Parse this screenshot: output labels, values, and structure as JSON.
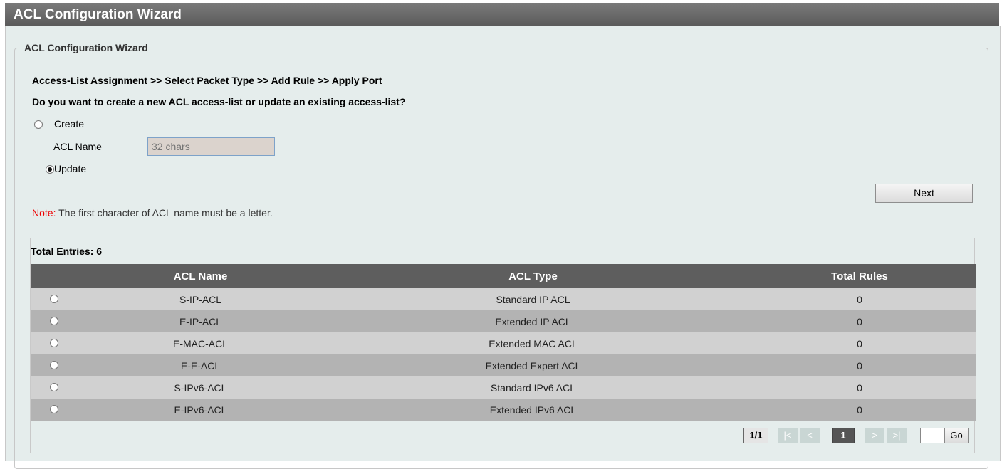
{
  "window": {
    "title": "ACL Configuration Wizard"
  },
  "wizard": {
    "legend": "ACL Configuration Wizard",
    "breadcrumb": {
      "current": "Access-List Assignment",
      "rest": " >> Select Packet Type >> Add Rule >> Apply Port"
    },
    "question": "Do you want to create a new ACL access-list or update an existing access-list?",
    "create_label": "Create",
    "acl_name_label": "ACL Name",
    "acl_name_placeholder": "32 chars",
    "update_label": "Update",
    "selected_option": "Update",
    "next_label": "Next",
    "note_label": "Note:",
    "note_text": "The first character of ACL name must be a letter."
  },
  "table": {
    "total_entries": "Total Entries: 6",
    "columns": [
      "",
      "ACL Name",
      "ACL Type",
      "Total Rules"
    ],
    "rows": [
      {
        "name": "S-IP-ACL",
        "type": "Standard IP ACL",
        "rules": "0"
      },
      {
        "name": "E-IP-ACL",
        "type": "Extended IP ACL",
        "rules": "0"
      },
      {
        "name": "E-MAC-ACL",
        "type": "Extended MAC ACL",
        "rules": "0"
      },
      {
        "name": "E-E-ACL",
        "type": "Extended Expert ACL",
        "rules": "0"
      },
      {
        "name": "S-IPv6-ACL",
        "type": "Standard IPv6 ACL",
        "rules": "0"
      },
      {
        "name": "E-IPv6-ACL",
        "type": "Extended IPv6 ACL",
        "rules": "0"
      }
    ]
  },
  "pagination": {
    "page_info": "1/1",
    "first": "|<",
    "prev": "<",
    "current": "1",
    "next": ">",
    "last": ">|",
    "go_label": "Go",
    "go_value": ""
  },
  "colors": {
    "header": "#5e5e5e",
    "row_odd": "#d1d1d1",
    "row_even": "#b3b3b3",
    "note": "#e00000",
    "background": "#e5edec"
  }
}
